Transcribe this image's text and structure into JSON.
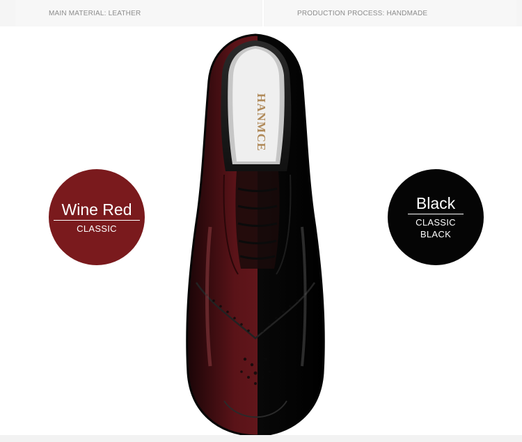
{
  "specs": {
    "material": "MAIN MATERIAL: LEATHER",
    "process": "PRODUCTION PROCESS: HANDMADE"
  },
  "swatches": {
    "wine": {
      "title": "Wine Red",
      "sub": "CLASSIC",
      "color": "#7a1a1d"
    },
    "black": {
      "title": "Black",
      "sub": "CLASSIC\nBLACK",
      "color": "#050505"
    }
  },
  "shoe": {
    "brand": "HANMCE",
    "left_color": "#4a0f14",
    "right_color": "#0c0c0c"
  }
}
